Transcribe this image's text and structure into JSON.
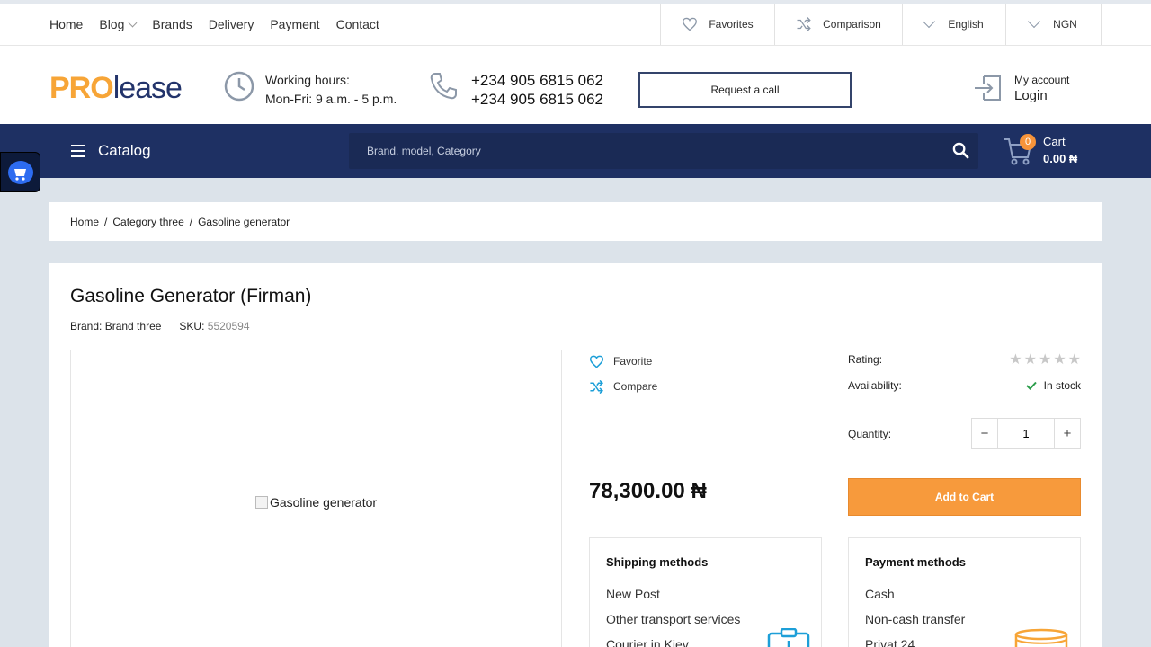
{
  "topnav": {
    "items": [
      "Home",
      "Blog",
      "Brands",
      "Delivery",
      "Payment",
      "Contact"
    ]
  },
  "topright": {
    "favorites": "Favorites",
    "comparison": "Comparison",
    "language": "English",
    "currency": "NGN"
  },
  "header": {
    "logo_pro": "PRO",
    "logo_lease": "lease",
    "hours_label": "Working hours:",
    "hours_value": "Mon-Fri: 9 a.m. - 5 p.m.",
    "phone1": "+234 905 6815 062",
    "phone2": "+234 905 6815 062",
    "request_call": "Request a call",
    "account_label": "My account",
    "login": "Login"
  },
  "nav": {
    "catalog": "Catalog",
    "search_placeholder": "Brand, model, Category",
    "cart_count": "0",
    "cart_label": "Cart",
    "cart_total": "0.00 ₦"
  },
  "breadcrumb": {
    "home": "Home",
    "category": "Category three",
    "current": "Gasoline generator"
  },
  "product": {
    "title": "Gasoline Generator (Firman)",
    "brand_label": "Brand:",
    "brand_value": "Brand three",
    "sku_label": "SKU:",
    "sku_value": "5520594",
    "image_alt": "Gasoline generator",
    "favorite": "Favorite",
    "compare": "Compare",
    "rating_label": "Rating:",
    "rating_value": 0,
    "availability_label": "Availability:",
    "availability_value": "In stock",
    "quantity_label": "Quantity:",
    "quantity_value": "1",
    "price": "78,300.00 ₦",
    "add_to_cart": "Add to Cart"
  },
  "shipping": {
    "title": "Shipping methods",
    "items": [
      "New Post",
      "Other transport services",
      "Courier in Kiev"
    ]
  },
  "payment": {
    "title": "Payment methods",
    "items": [
      "Cash",
      "Non-cash transfer",
      "Privat 24"
    ]
  },
  "colors": {
    "navy": "#1e3063",
    "accent_orange": "#f79a3c",
    "icon_blue": "#1d9fd8",
    "in_stock_green": "#2a9d4a"
  }
}
